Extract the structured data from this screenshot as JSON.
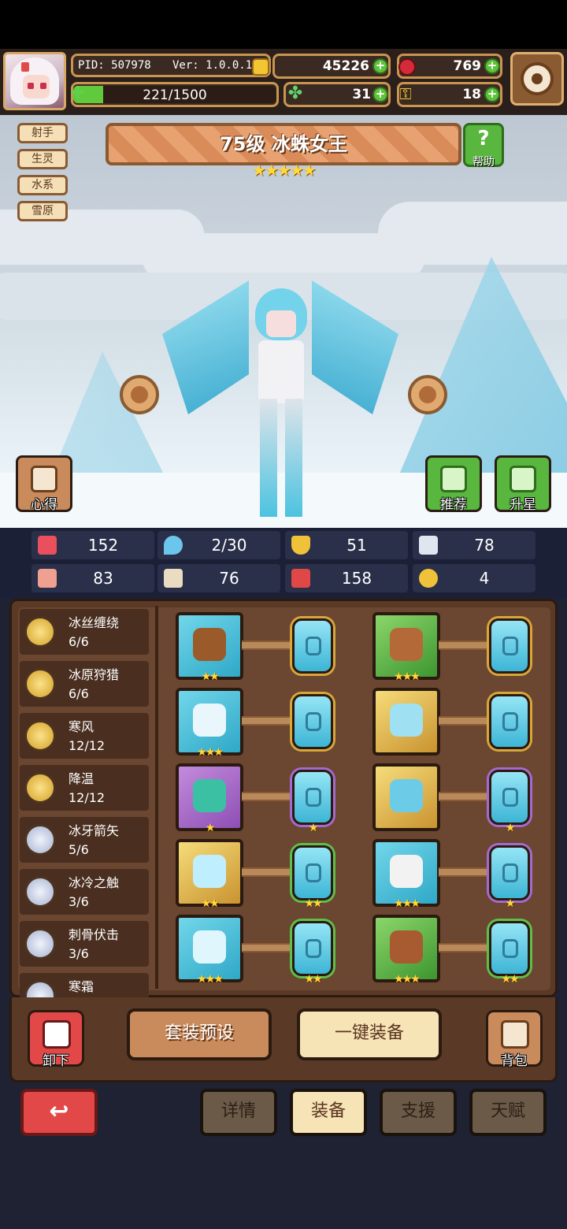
{
  "header": {
    "pid": "PID: 507978",
    "version": "Ver: 1.0.0.10",
    "xp_text": "221/1500",
    "xp_progress": 0.147,
    "gold": "45226",
    "gems": "769",
    "clover": "31",
    "keys": "18"
  },
  "hero": {
    "title": "75级 冰蛛女王",
    "stars": "★★★★★",
    "tags": [
      "射手",
      "生灵",
      "水系",
      "雪原"
    ],
    "help_label": "帮助"
  },
  "scene_buttons": {
    "notes": "心得",
    "recommend": "推荐",
    "star_up": "升星"
  },
  "stats": [
    {
      "icon": "heart-icon",
      "value": "152",
      "color": "#e8505e"
    },
    {
      "icon": "drop-icon",
      "value": "2/30",
      "color": "#6cc6ec"
    },
    {
      "icon": "shield-icon",
      "value": "51",
      "color": "#f0c23a"
    },
    {
      "icon": "wing-icon",
      "value": "78",
      "color": "#dfe6f0"
    },
    {
      "icon": "fist-icon",
      "value": "83",
      "color": "#f0a090"
    },
    {
      "icon": "book-icon",
      "value": "76",
      "color": "#e9dcc0"
    },
    {
      "icon": "spellbook-icon",
      "value": "158",
      "color": "#e04848"
    },
    {
      "icon": "horseshoe-icon",
      "value": "4",
      "color": "#f0c23a"
    }
  ],
  "sets": [
    {
      "name": "冰丝缠绕",
      "count": "6/6",
      "medal": "gold"
    },
    {
      "name": "冰原狩猎",
      "count": "6/6",
      "medal": "gold"
    },
    {
      "name": "寒风",
      "count": "12/12",
      "medal": "gold"
    },
    {
      "name": "降温",
      "count": "12/12",
      "medal": "gold"
    },
    {
      "name": "冰牙箭矢",
      "count": "5/6",
      "medal": "silver"
    },
    {
      "name": "冰冷之触",
      "count": "3/6",
      "medal": "silver"
    },
    {
      "name": "刺骨伏击",
      "count": "3/6",
      "medal": "silver"
    },
    {
      "name": "寒霜",
      "count": "",
      "medal": "silver"
    }
  ],
  "equipment": {
    "left": [
      {
        "icon": "crossbow-icon",
        "frame": "blue",
        "stars": "★★",
        "rune": "gold",
        "rune_stars": ""
      },
      {
        "icon": "arrow-icon",
        "frame": "blue",
        "stars": "★★★",
        "rune": "gold",
        "rune_stars": ""
      },
      {
        "icon": "necklace-icon",
        "frame": "purple",
        "stars": "★",
        "rune": "purple",
        "rune_stars": "★"
      },
      {
        "icon": "ice-crystal-icon",
        "frame": "gold",
        "stars": "★★",
        "rune": "green",
        "rune_stars": "★★"
      },
      {
        "icon": "ring-icon",
        "frame": "blue",
        "stars": "★★★",
        "rune": "green",
        "rune_stars": "★★"
      }
    ],
    "right": [
      {
        "icon": "helmet-icon",
        "frame": "green",
        "stars": "★★★",
        "rune": "gold",
        "rune_stars": ""
      },
      {
        "icon": "armor-icon",
        "frame": "gold",
        "stars": "",
        "rune": "gold",
        "rune_stars": ""
      },
      {
        "icon": "glove-icon",
        "frame": "gold",
        "stars": "",
        "rune": "purple",
        "rune_stars": "★"
      },
      {
        "icon": "belt-icon",
        "frame": "blue",
        "stars": "★★★",
        "rune": "purple",
        "rune_stars": "★"
      },
      {
        "icon": "boots-icon",
        "frame": "green",
        "stars": "★★★",
        "rune": "green",
        "rune_stars": "★★"
      }
    ]
  },
  "actions": {
    "unequip": "卸下",
    "preset": "套装预设",
    "auto_equip": "一键装备",
    "bag": "背包"
  },
  "tabs": [
    {
      "label": "详情",
      "active": false
    },
    {
      "label": "装备",
      "active": true
    },
    {
      "label": "支援",
      "active": false
    },
    {
      "label": "天赋",
      "active": false
    }
  ],
  "back_label": "↩"
}
